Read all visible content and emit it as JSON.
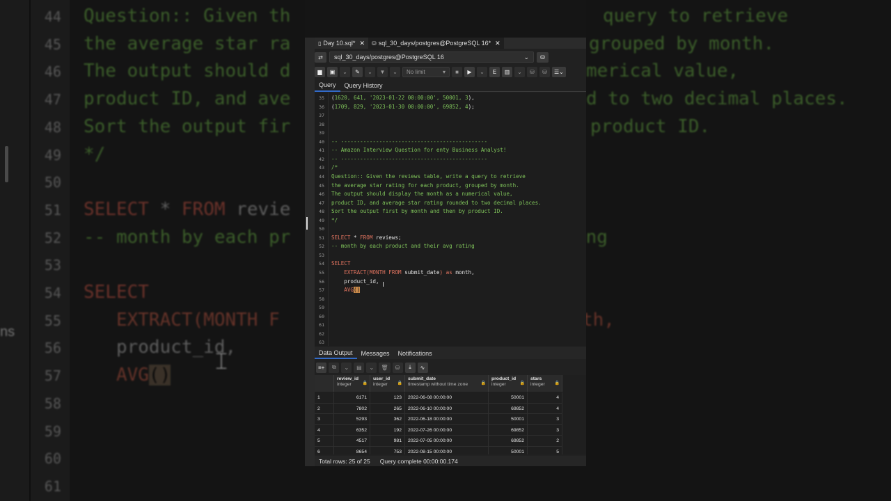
{
  "background": {
    "lines": [
      {
        "n": "44",
        "parts": [
          {
            "c": "com",
            "t": "Question:: Given th"
          }
        ]
      },
      {
        "n": "45",
        "parts": [
          {
            "c": "com",
            "t": "the average star ra"
          }
        ]
      },
      {
        "n": "46",
        "parts": [
          {
            "c": "com",
            "t": "The output should d"
          }
        ]
      },
      {
        "n": "47",
        "parts": [
          {
            "c": "com",
            "t": "product ID, and ave"
          }
        ]
      },
      {
        "n": "48",
        "parts": [
          {
            "c": "com",
            "t": "Sort the output fir"
          }
        ]
      },
      {
        "n": "49",
        "parts": [
          {
            "c": "com",
            "t": "*/"
          }
        ]
      },
      {
        "n": "50",
        "parts": []
      },
      {
        "n": "51",
        "parts": [
          {
            "c": "kw",
            "t": "SELECT"
          },
          {
            "c": "id",
            "t": " * "
          },
          {
            "c": "kw",
            "t": "FROM"
          },
          {
            "c": "id",
            "t": " revie"
          }
        ]
      },
      {
        "n": "52",
        "parts": [
          {
            "c": "com",
            "t": "-- month by each pr"
          }
        ]
      },
      {
        "n": "53",
        "parts": []
      },
      {
        "n": "54",
        "parts": [
          {
            "c": "kw",
            "t": "SELECT"
          }
        ]
      },
      {
        "n": "55",
        "parts": [
          {
            "c": "fn",
            "t": "   EXTRACT(MONTH F"
          }
        ]
      },
      {
        "n": "56",
        "parts": [
          {
            "c": "id",
            "t": "   product_id,"
          }
        ]
      },
      {
        "n": "57",
        "parts": [
          {
            "c": "fn",
            "t": "   AVG"
          },
          {
            "c": "hl",
            "t": "()"
          }
        ]
      },
      {
        "n": "58",
        "parts": []
      },
      {
        "n": "59",
        "parts": []
      },
      {
        "n": "60",
        "parts": []
      },
      {
        "n": "61",
        "parts": []
      }
    ],
    "right_lines": [
      {
        "row": 0,
        "c": "com",
        "t": "query to retrieve"
      },
      {
        "row": 1,
        "c": "com",
        "t": "grouped by month."
      },
      {
        "row": 2,
        "c": "com",
        "t": "merical value,"
      },
      {
        "row": 3,
        "c": "com",
        "t": "d to two decimal places."
      },
      {
        "row": 4,
        "c": "com",
        "t": "product ID."
      },
      {
        "row": 8,
        "c": "com",
        "t": "ing"
      },
      {
        "row": 11,
        "c": "fn",
        "t": "th,"
      }
    ],
    "side_text": "ns"
  },
  "tabs": [
    {
      "label": "Day 10.sql*",
      "icon": "file-icon",
      "active": false
    },
    {
      "label": "sql_30_days/postgres@PostgreSQL 16*",
      "icon": "database-icon",
      "active": true
    }
  ],
  "connection": {
    "label": "sql_30_days/postgres@PostgreSQL 16"
  },
  "toolbar": {
    "limit_label": "No limit"
  },
  "editor_tabs": [
    "Query",
    "Query History"
  ],
  "editor_lines": [
    {
      "n": "35",
      "parts": [
        {
          "c": "id",
          "t": "("
        },
        {
          "c": "str",
          "t": "1620, 641, '2023-01-22 00:00:00', 50001, 3"
        },
        {
          "c": "id",
          "t": "),"
        }
      ]
    },
    {
      "n": "36",
      "parts": [
        {
          "c": "id",
          "t": "("
        },
        {
          "c": "str",
          "t": "1709, 829, '2023-01-30 00:00:00', 69852, 4"
        },
        {
          "c": "id",
          "t": ");"
        }
      ]
    },
    {
      "n": "37",
      "parts": []
    },
    {
      "n": "38",
      "parts": []
    },
    {
      "n": "39",
      "parts": []
    },
    {
      "n": "40",
      "parts": [
        {
          "c": "com",
          "t": "-- ----------------------------------------------"
        }
      ]
    },
    {
      "n": "41",
      "parts": [
        {
          "c": "com",
          "t": "-- Amazon Interview Question for enty Business Analyst!"
        }
      ]
    },
    {
      "n": "42",
      "parts": [
        {
          "c": "com",
          "t": "-- ----------------------------------------------"
        }
      ]
    },
    {
      "n": "43",
      "parts": [
        {
          "c": "com",
          "t": "/*"
        }
      ]
    },
    {
      "n": "44",
      "parts": [
        {
          "c": "com",
          "t": "Question:: Given the reviews table, write a query to retrieve"
        }
      ]
    },
    {
      "n": "45",
      "parts": [
        {
          "c": "com",
          "t": "the average star rating for each product, grouped by month."
        }
      ]
    },
    {
      "n": "46",
      "parts": [
        {
          "c": "com",
          "t": "The output should display the month as a numerical value,"
        }
      ]
    },
    {
      "n": "47",
      "parts": [
        {
          "c": "com",
          "t": "product ID, and average star rating rounded to two decimal places."
        }
      ]
    },
    {
      "n": "48",
      "parts": [
        {
          "c": "com",
          "t": "Sort the output first by month and then by product ID."
        }
      ]
    },
    {
      "n": "49",
      "parts": [
        {
          "c": "com",
          "t": "*/"
        }
      ]
    },
    {
      "n": "50",
      "parts": []
    },
    {
      "n": "51",
      "parts": [
        {
          "c": "kw",
          "t": "SELECT"
        },
        {
          "c": "id",
          "t": " * "
        },
        {
          "c": "kw",
          "t": "FROM"
        },
        {
          "c": "id",
          "t": " reviews;"
        }
      ]
    },
    {
      "n": "52",
      "parts": [
        {
          "c": "com",
          "t": "-- month by each product and their avg rating"
        }
      ]
    },
    {
      "n": "53",
      "parts": []
    },
    {
      "n": "54",
      "parts": [
        {
          "c": "kw",
          "t": "SELECT"
        }
      ]
    },
    {
      "n": "55",
      "parts": [
        {
          "c": "kw",
          "t": "    EXTRACT(MONTH FROM "
        },
        {
          "c": "id",
          "t": "submit_date"
        },
        {
          "c": "kw",
          "t": ") as "
        },
        {
          "c": "id",
          "t": "month,"
        }
      ]
    },
    {
      "n": "56",
      "parts": [
        {
          "c": "id",
          "t": "    product_id,"
        }
      ]
    },
    {
      "n": "57",
      "parts": [
        {
          "c": "kw",
          "t": "    AVG"
        },
        {
          "c": "hl",
          "t": "()"
        }
      ]
    },
    {
      "n": "58",
      "parts": []
    },
    {
      "n": "59",
      "parts": []
    },
    {
      "n": "60",
      "parts": []
    },
    {
      "n": "61",
      "parts": []
    },
    {
      "n": "62",
      "parts": []
    },
    {
      "n": "63",
      "parts": []
    }
  ],
  "output_tabs": [
    "Data Output",
    "Messages",
    "Notifications"
  ],
  "grid": {
    "columns": [
      {
        "name": "review_id",
        "type": "integer"
      },
      {
        "name": "user_id",
        "type": "integer"
      },
      {
        "name": "submit_date",
        "type": "timestamp without time zone"
      },
      {
        "name": "product_id",
        "type": "integer"
      },
      {
        "name": "stars",
        "type": "integer"
      }
    ],
    "rows": [
      {
        "n": "1",
        "cells": [
          "6171",
          "123",
          "2022-06-08 00:00:00",
          "50001",
          "4"
        ]
      },
      {
        "n": "2",
        "cells": [
          "7802",
          "265",
          "2022-06-10 00:00:00",
          "69852",
          "4"
        ]
      },
      {
        "n": "3",
        "cells": [
          "5293",
          "362",
          "2022-06-18 00:00:00",
          "50001",
          "3"
        ]
      },
      {
        "n": "4",
        "cells": [
          "6352",
          "192",
          "2022-07-26 00:00:00",
          "69852",
          "3"
        ]
      },
      {
        "n": "5",
        "cells": [
          "4517",
          "981",
          "2022-07-05 00:00:00",
          "69852",
          "2"
        ]
      },
      {
        "n": "6",
        "cells": [
          "8654",
          "753",
          "2022-08-15 00:00:00",
          "50001",
          "5"
        ]
      }
    ]
  },
  "status": {
    "total_rows": "Total rows: 25 of 25",
    "query_status": "Query complete 00:00:00.174"
  }
}
